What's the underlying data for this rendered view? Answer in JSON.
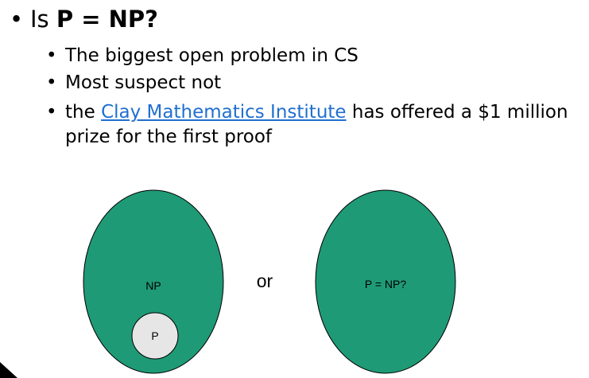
{
  "slide": {
    "heading": {
      "prefix": "Is ",
      "bold": "P = NP?"
    },
    "bullets": [
      {
        "text": "The biggest open problem in CS"
      },
      {
        "text": "Most suspect not"
      },
      {
        "before": "the ",
        "link": "Clay Mathematics Institute",
        "after": " has offered a $1 million",
        "continuation": "prize for the first proof"
      }
    ]
  },
  "diagram": {
    "left": {
      "outer_label": "NP",
      "inner_label": "P"
    },
    "connector": "or",
    "right": {
      "label": "P = NP?"
    },
    "colors": {
      "set_fill": "#1f9a76",
      "inner_fill": "#e6e6e6",
      "outline": "#000000"
    }
  }
}
